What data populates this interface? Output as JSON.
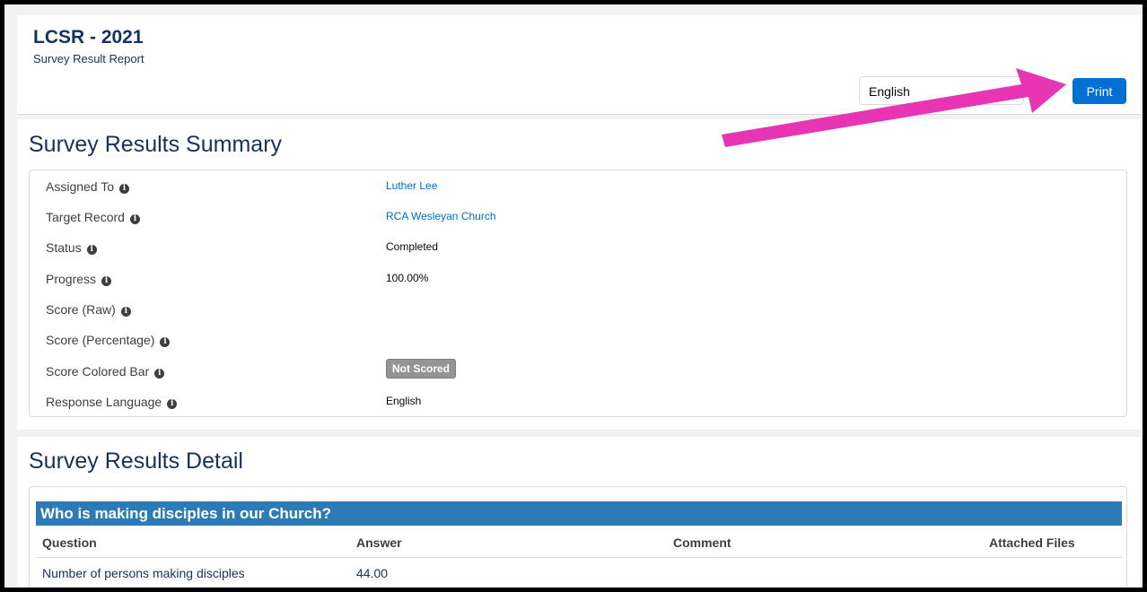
{
  "header": {
    "title": "LCSR - 2021",
    "subtitle": "Survey Result Report",
    "language_select": {
      "value": "English"
    },
    "print_label": "Print"
  },
  "summary": {
    "title": "Survey Results Summary",
    "fields": [
      {
        "label": "Assigned To",
        "value": "Luther Lee"
      },
      {
        "label": "Target Record",
        "value": "RCA Wesleyan Church"
      },
      {
        "label": "Status",
        "value": "Completed"
      },
      {
        "label": "Progress",
        "value": "100.00%"
      },
      {
        "label": "Score (Raw)",
        "value": ""
      },
      {
        "label": "Score (Percentage)",
        "value": ""
      },
      {
        "label": "Score Colored Bar",
        "value": "Not Scored"
      },
      {
        "label": "Response Language",
        "value": "English"
      }
    ]
  },
  "detail": {
    "title": "Survey Results Detail",
    "group_title": "Who is making disciples in our Church?",
    "columns": [
      "Question",
      "Answer",
      "Comment",
      "Attached Files"
    ],
    "rows": [
      {
        "question": "Number of persons making disciples",
        "answer": "44.00",
        "comment": "",
        "files": ""
      }
    ]
  },
  "colors": {
    "brand_blue": "#0070d2",
    "heading_navy": "#16325c",
    "group_header": "#2d7bb6",
    "link": "#006dcc",
    "annotation_arrow": "#e835b4"
  },
  "icons": [
    "info-icon",
    "chevron-down-icon",
    "annotation-arrow"
  ]
}
